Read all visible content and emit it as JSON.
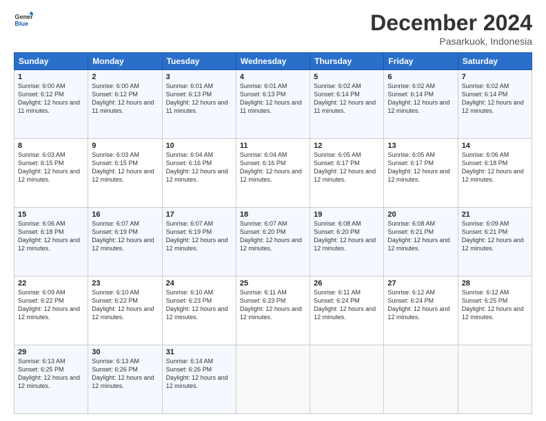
{
  "logo": {
    "line1": "General",
    "line2": "Blue"
  },
  "title": "December 2024",
  "subtitle": "Pasarkuok, Indonesia",
  "days_header": [
    "Sunday",
    "Monday",
    "Tuesday",
    "Wednesday",
    "Thursday",
    "Friday",
    "Saturday"
  ],
  "weeks": [
    [
      {
        "day": "1",
        "sunrise": "6:00 AM",
        "sunset": "6:12 PM",
        "daylight": "12 hours and 11 minutes."
      },
      {
        "day": "2",
        "sunrise": "6:00 AM",
        "sunset": "6:12 PM",
        "daylight": "12 hours and 11 minutes."
      },
      {
        "day": "3",
        "sunrise": "6:01 AM",
        "sunset": "6:13 PM",
        "daylight": "12 hours and 11 minutes."
      },
      {
        "day": "4",
        "sunrise": "6:01 AM",
        "sunset": "6:13 PM",
        "daylight": "12 hours and 11 minutes."
      },
      {
        "day": "5",
        "sunrise": "6:02 AM",
        "sunset": "6:14 PM",
        "daylight": "12 hours and 11 minutes."
      },
      {
        "day": "6",
        "sunrise": "6:02 AM",
        "sunset": "6:14 PM",
        "daylight": "12 hours and 12 minutes."
      },
      {
        "day": "7",
        "sunrise": "6:02 AM",
        "sunset": "6:14 PM",
        "daylight": "12 hours and 12 minutes."
      }
    ],
    [
      {
        "day": "8",
        "sunrise": "6:03 AM",
        "sunset": "6:15 PM",
        "daylight": "12 hours and 12 minutes."
      },
      {
        "day": "9",
        "sunrise": "6:03 AM",
        "sunset": "6:15 PM",
        "daylight": "12 hours and 12 minutes."
      },
      {
        "day": "10",
        "sunrise": "6:04 AM",
        "sunset": "6:16 PM",
        "daylight": "12 hours and 12 minutes."
      },
      {
        "day": "11",
        "sunrise": "6:04 AM",
        "sunset": "6:16 PM",
        "daylight": "12 hours and 12 minutes."
      },
      {
        "day": "12",
        "sunrise": "6:05 AM",
        "sunset": "6:17 PM",
        "daylight": "12 hours and 12 minutes."
      },
      {
        "day": "13",
        "sunrise": "6:05 AM",
        "sunset": "6:17 PM",
        "daylight": "12 hours and 12 minutes."
      },
      {
        "day": "14",
        "sunrise": "6:06 AM",
        "sunset": "6:18 PM",
        "daylight": "12 hours and 12 minutes."
      }
    ],
    [
      {
        "day": "15",
        "sunrise": "6:06 AM",
        "sunset": "6:18 PM",
        "daylight": "12 hours and 12 minutes."
      },
      {
        "day": "16",
        "sunrise": "6:07 AM",
        "sunset": "6:19 PM",
        "daylight": "12 hours and 12 minutes."
      },
      {
        "day": "17",
        "sunrise": "6:07 AM",
        "sunset": "6:19 PM",
        "daylight": "12 hours and 12 minutes."
      },
      {
        "day": "18",
        "sunrise": "6:07 AM",
        "sunset": "6:20 PM",
        "daylight": "12 hours and 12 minutes."
      },
      {
        "day": "19",
        "sunrise": "6:08 AM",
        "sunset": "6:20 PM",
        "daylight": "12 hours and 12 minutes."
      },
      {
        "day": "20",
        "sunrise": "6:08 AM",
        "sunset": "6:21 PM",
        "daylight": "12 hours and 12 minutes."
      },
      {
        "day": "21",
        "sunrise": "6:09 AM",
        "sunset": "6:21 PM",
        "daylight": "12 hours and 12 minutes."
      }
    ],
    [
      {
        "day": "22",
        "sunrise": "6:09 AM",
        "sunset": "6:22 PM",
        "daylight": "12 hours and 12 minutes."
      },
      {
        "day": "23",
        "sunrise": "6:10 AM",
        "sunset": "6:22 PM",
        "daylight": "12 hours and 12 minutes."
      },
      {
        "day": "24",
        "sunrise": "6:10 AM",
        "sunset": "6:23 PM",
        "daylight": "12 hours and 12 minutes."
      },
      {
        "day": "25",
        "sunrise": "6:11 AM",
        "sunset": "6:23 PM",
        "daylight": "12 hours and 12 minutes."
      },
      {
        "day": "26",
        "sunrise": "6:11 AM",
        "sunset": "6:24 PM",
        "daylight": "12 hours and 12 minutes."
      },
      {
        "day": "27",
        "sunrise": "6:12 AM",
        "sunset": "6:24 PM",
        "daylight": "12 hours and 12 minutes."
      },
      {
        "day": "28",
        "sunrise": "6:12 AM",
        "sunset": "6:25 PM",
        "daylight": "12 hours and 12 minutes."
      }
    ],
    [
      {
        "day": "29",
        "sunrise": "6:13 AM",
        "sunset": "6:25 PM",
        "daylight": "12 hours and 12 minutes."
      },
      {
        "day": "30",
        "sunrise": "6:13 AM",
        "sunset": "6:26 PM",
        "daylight": "12 hours and 12 minutes."
      },
      {
        "day": "31",
        "sunrise": "6:14 AM",
        "sunset": "6:26 PM",
        "daylight": "12 hours and 12 minutes."
      },
      null,
      null,
      null,
      null
    ]
  ]
}
